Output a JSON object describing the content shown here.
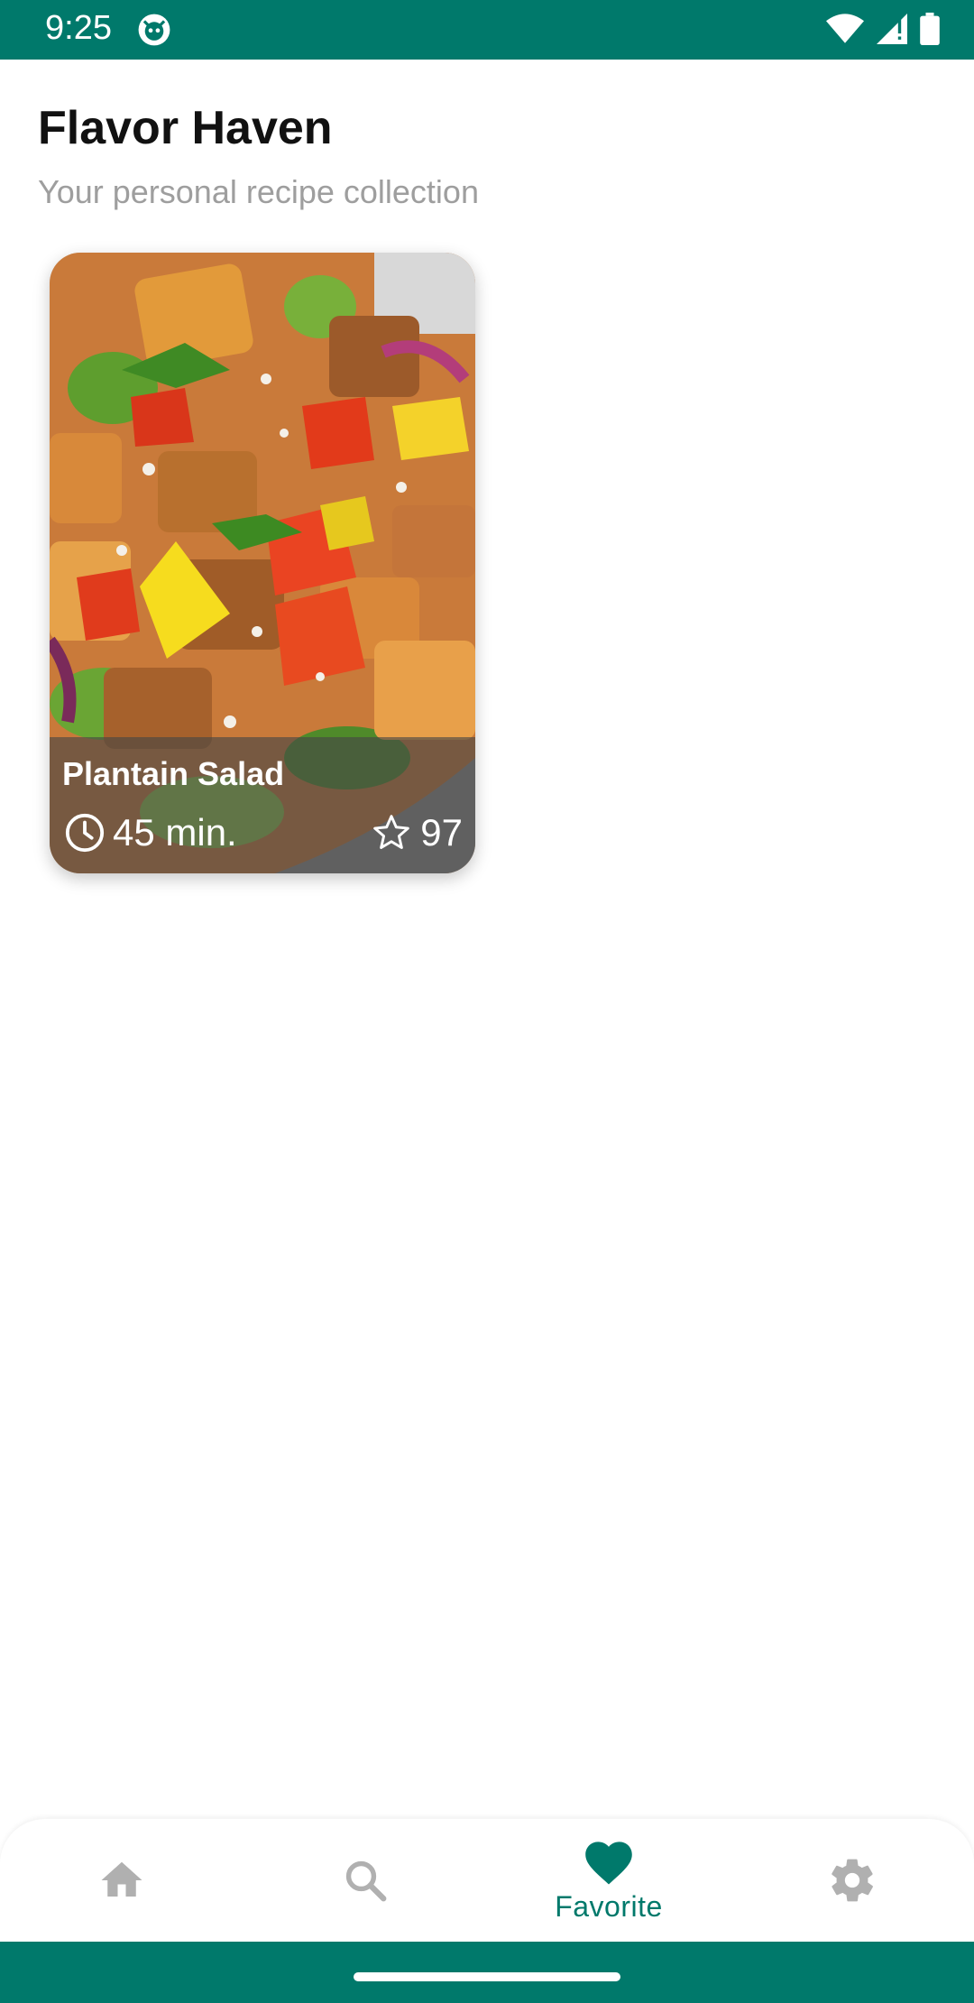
{
  "status_bar": {
    "time": "9:25",
    "background": "#00796b",
    "icons": [
      "app-notification-icon",
      "wifi-icon",
      "signal-icon",
      "battery-icon"
    ]
  },
  "header": {
    "title": "Flavor Haven",
    "subtitle": "Your personal recipe collection"
  },
  "recipes": [
    {
      "name": "Plantain Salad",
      "time": "45 min.",
      "rating": "97",
      "image": "salad-photo"
    }
  ],
  "bottom_nav": {
    "accent": "#00796b",
    "inactive_color": "#b0b0b0",
    "items": [
      {
        "icon": "home-icon",
        "label": "",
        "active": false
      },
      {
        "icon": "search-icon",
        "label": "",
        "active": false
      },
      {
        "icon": "heart-icon",
        "label": "Favorite",
        "active": true
      },
      {
        "icon": "gear-icon",
        "label": "",
        "active": false
      }
    ]
  }
}
